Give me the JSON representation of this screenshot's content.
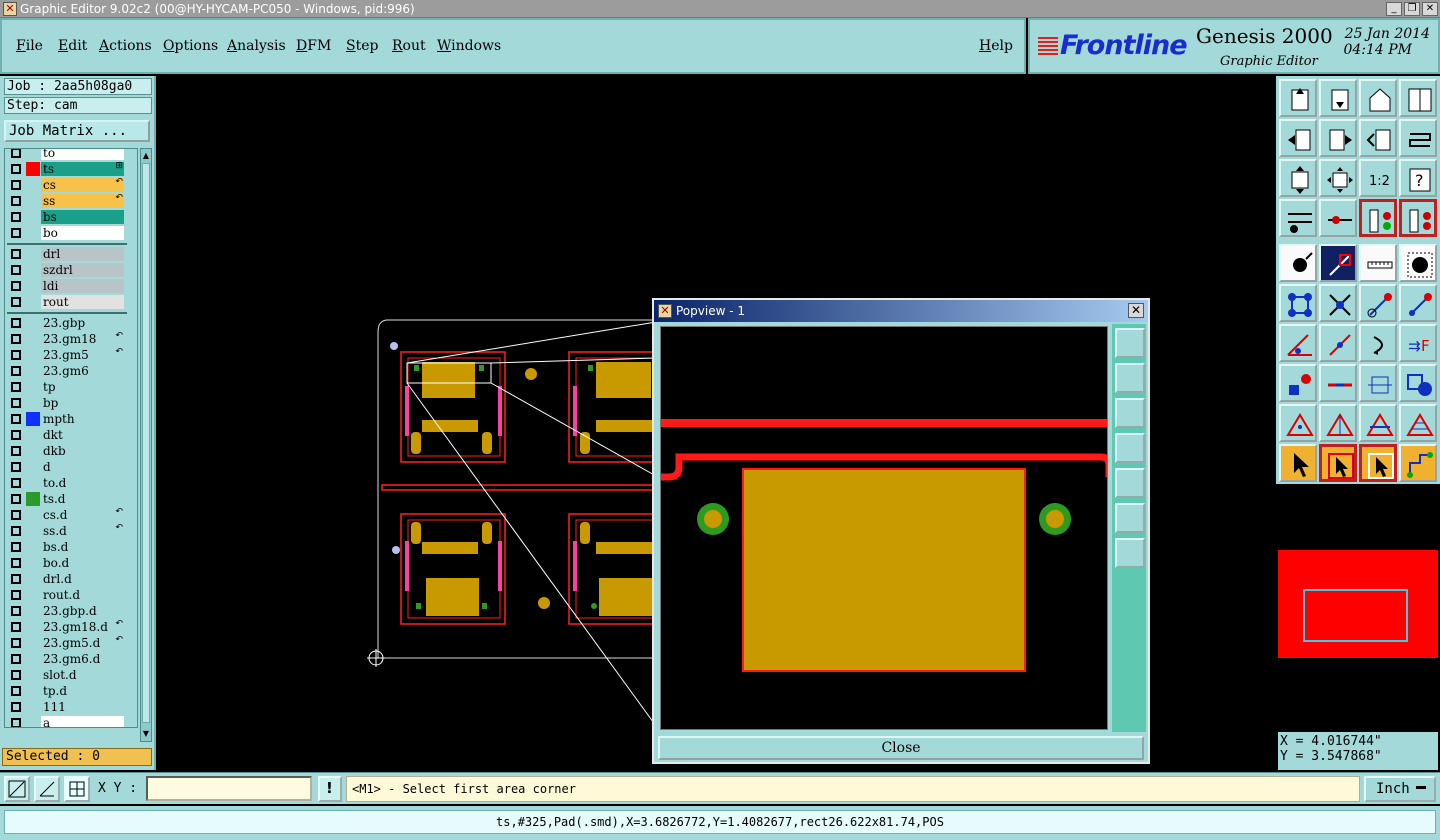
{
  "window": {
    "title": "Graphic Editor 9.02c2 (00@HY-HYCAM-PC050 - Windows, pid:996)",
    "controls": [
      "_",
      "❐",
      "✕"
    ]
  },
  "menu": {
    "items": [
      "File",
      "Edit",
      "Actions",
      "Options",
      "Analysis",
      "DFM",
      "Step",
      "Rout",
      "Windows"
    ],
    "help": "Help"
  },
  "brand": {
    "logo": "Frontline",
    "product": "Genesis 2000",
    "subtitle": "Graphic Editor",
    "date": "25 Jan 2014",
    "time": "04:14 PM"
  },
  "job": {
    "job_line": "Job : 2aa5h08ga0",
    "step_line": "Step: cam",
    "matrix_button": "Job Matrix ..."
  },
  "layers": [
    {
      "name": "to",
      "color": "#ffffff",
      "swatch": "",
      "marker": ""
    },
    {
      "name": "ts",
      "color": "#1aa088",
      "swatch": "#ff0000",
      "marker": "⊞"
    },
    {
      "name": "cs",
      "color": "#f6c24a",
      "swatch": "",
      "marker": "↶"
    },
    {
      "name": "ss",
      "color": "#f6c24a",
      "swatch": "",
      "marker": "↶"
    },
    {
      "name": "bs",
      "color": "#1aa088",
      "swatch": "",
      "marker": ""
    },
    {
      "name": "bo",
      "color": "#ffffff",
      "swatch": "",
      "marker": ""
    },
    {
      "name": "drl",
      "color": "#b9c4c8",
      "swatch": "",
      "marker": ""
    },
    {
      "name": "szdrl",
      "color": "#b9c4c8",
      "swatch": "",
      "marker": ""
    },
    {
      "name": "ldi",
      "color": "#b9c4c8",
      "swatch": "",
      "marker": ""
    },
    {
      "name": "rout",
      "color": "#e2e2e2",
      "swatch": "",
      "marker": ""
    },
    {
      "name": "23.gbp",
      "color": "#a3d9d9",
      "swatch": "",
      "marker": ""
    },
    {
      "name": "23.gm18",
      "color": "#a3d9d9",
      "swatch": "",
      "marker": "↶"
    },
    {
      "name": "23.gm5",
      "color": "#a3d9d9",
      "swatch": "",
      "marker": "↶"
    },
    {
      "name": "23.gm6",
      "color": "#a3d9d9",
      "swatch": "",
      "marker": ""
    },
    {
      "name": "tp",
      "color": "#a3d9d9",
      "swatch": "",
      "marker": ""
    },
    {
      "name": "bp",
      "color": "#a3d9d9",
      "swatch": "",
      "marker": ""
    },
    {
      "name": "mpth",
      "color": "#a3d9d9",
      "swatch": "#1030ff",
      "marker": ""
    },
    {
      "name": "dkt",
      "color": "#a3d9d9",
      "swatch": "",
      "marker": ""
    },
    {
      "name": "dkb",
      "color": "#a3d9d9",
      "swatch": "",
      "marker": ""
    },
    {
      "name": "d",
      "color": "#a3d9d9",
      "swatch": "",
      "marker": ""
    },
    {
      "name": "to.d",
      "color": "#a3d9d9",
      "swatch": "",
      "marker": ""
    },
    {
      "name": "ts.d",
      "color": "#a3d9d9",
      "swatch": "#2a9a2a",
      "marker": ""
    },
    {
      "name": "cs.d",
      "color": "#a3d9d9",
      "swatch": "",
      "marker": "↶"
    },
    {
      "name": "ss.d",
      "color": "#a3d9d9",
      "swatch": "",
      "marker": "↶"
    },
    {
      "name": "bs.d",
      "color": "#a3d9d9",
      "swatch": "",
      "marker": ""
    },
    {
      "name": "bo.d",
      "color": "#a3d9d9",
      "swatch": "",
      "marker": ""
    },
    {
      "name": "drl.d",
      "color": "#a3d9d9",
      "swatch": "",
      "marker": ""
    },
    {
      "name": "rout.d",
      "color": "#a3d9d9",
      "swatch": "",
      "marker": ""
    },
    {
      "name": "23.gbp.d",
      "color": "#a3d9d9",
      "swatch": "",
      "marker": ""
    },
    {
      "name": "23.gm18.d",
      "color": "#a3d9d9",
      "swatch": "",
      "marker": "↶"
    },
    {
      "name": "23.gm5.d",
      "color": "#a3d9d9",
      "swatch": "",
      "marker": "↶"
    },
    {
      "name": "23.gm6.d",
      "color": "#a3d9d9",
      "swatch": "",
      "marker": ""
    },
    {
      "name": "slot.d",
      "color": "#a3d9d9",
      "swatch": "",
      "marker": ""
    },
    {
      "name": "tp.d",
      "color": "#a3d9d9",
      "swatch": "",
      "marker": ""
    },
    {
      "name": "111",
      "color": "#a3d9d9",
      "swatch": "",
      "marker": ""
    },
    {
      "name": "a",
      "color": "#ffffff",
      "swatch": "",
      "marker": ""
    }
  ],
  "selected": "Selected : 0",
  "popview": {
    "title": "Popview - 1",
    "close_label": "Close",
    "tools": [
      "zoom-window-icon",
      "zoom-home-icon",
      "zoom-down-icon",
      "pan-left-icon",
      "pan-right-icon",
      "fit-all-icon",
      "center-icon"
    ]
  },
  "toolbar": {
    "icons": [
      "zoom-up-icon",
      "zoom-down-icon",
      "zoom-home-icon",
      "split-view-icon",
      "pan-left-icon",
      "pan-right-icon",
      "pan-back-icon",
      "pan-wave-icon",
      "fit-icon",
      "center-icon",
      "scale-icon",
      "help-icon",
      "tools-icon",
      "snap-icon",
      "layer-toggle-icon",
      "layer-toggle-red-icon",
      "pad-select-icon",
      "measure-angle-icon",
      "ruler-icon",
      "circle-icon",
      "connect-icon",
      "cross-icon",
      "arrow-red-icon",
      "arrow-red2-icon",
      "angle-icon",
      "line-icon",
      "arc-icon",
      "flip-icon",
      "move-icon",
      "cut-icon",
      "resize-icon",
      "shape-icon",
      "triangle-icon",
      "triangle2-icon",
      "triangle3-icon",
      "triangle4-icon",
      "pointer-icon",
      "select-box-icon",
      "select-orange-icon",
      "route-icon"
    ],
    "scale_label": "1:2",
    "help_glyph": "?"
  },
  "coords": {
    "x": "X = 4.016744\"",
    "y": "Y = 3.547868\""
  },
  "command": {
    "xy_label": "X Y :",
    "xy_value": "",
    "warn_glyph": "!",
    "prompt": "<M1> - Select first area corner",
    "unit": "Inch"
  },
  "status": "ts,#325,Pad(.smd),X=3.6826772,Y=1.4082677,rect26.622x81.74,POS",
  "colors": {
    "panel": "#a3d9d9",
    "copper": "#c89a00",
    "outline_red": "#ff1a1a",
    "pad_green": "#2e9a20"
  }
}
